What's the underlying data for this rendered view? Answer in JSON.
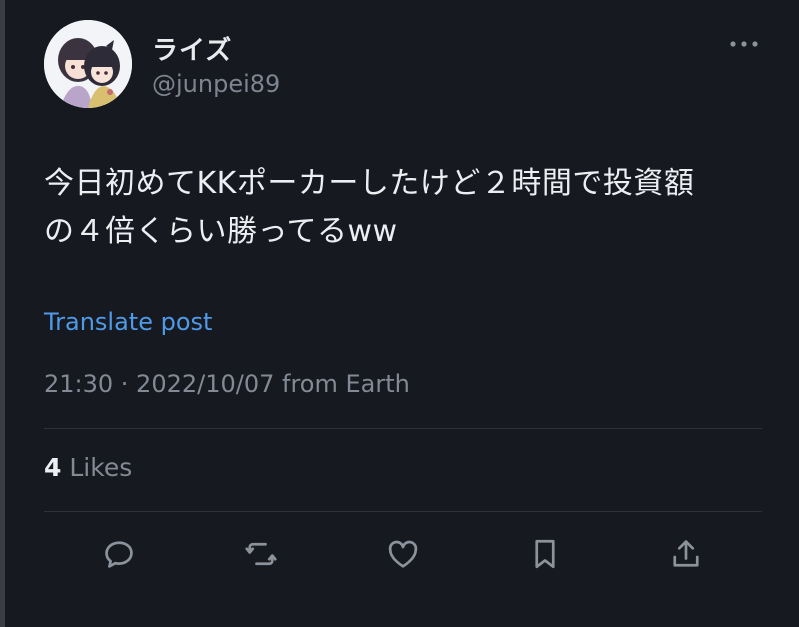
{
  "user": {
    "display_name": "ライズ",
    "handle": "@junpei89"
  },
  "post": {
    "text_line1": "今日初めてKKポーカーしたけど２時間で投資額",
    "text_line2": "の４倍くらい勝ってるww",
    "translate_label": "Translate post",
    "timestamp": "21:30 · 2022/10/07 from Earth"
  },
  "stats": {
    "likes_count": "4",
    "likes_label": "Likes"
  },
  "icons": [
    "more-icon",
    "reply-icon",
    "repost-icon",
    "like-icon",
    "bookmark-icon",
    "share-icon"
  ],
  "colors": {
    "background": "#16191f",
    "text": "#eceef1",
    "secondary": "#838a95",
    "link": "#4f9ae8"
  }
}
